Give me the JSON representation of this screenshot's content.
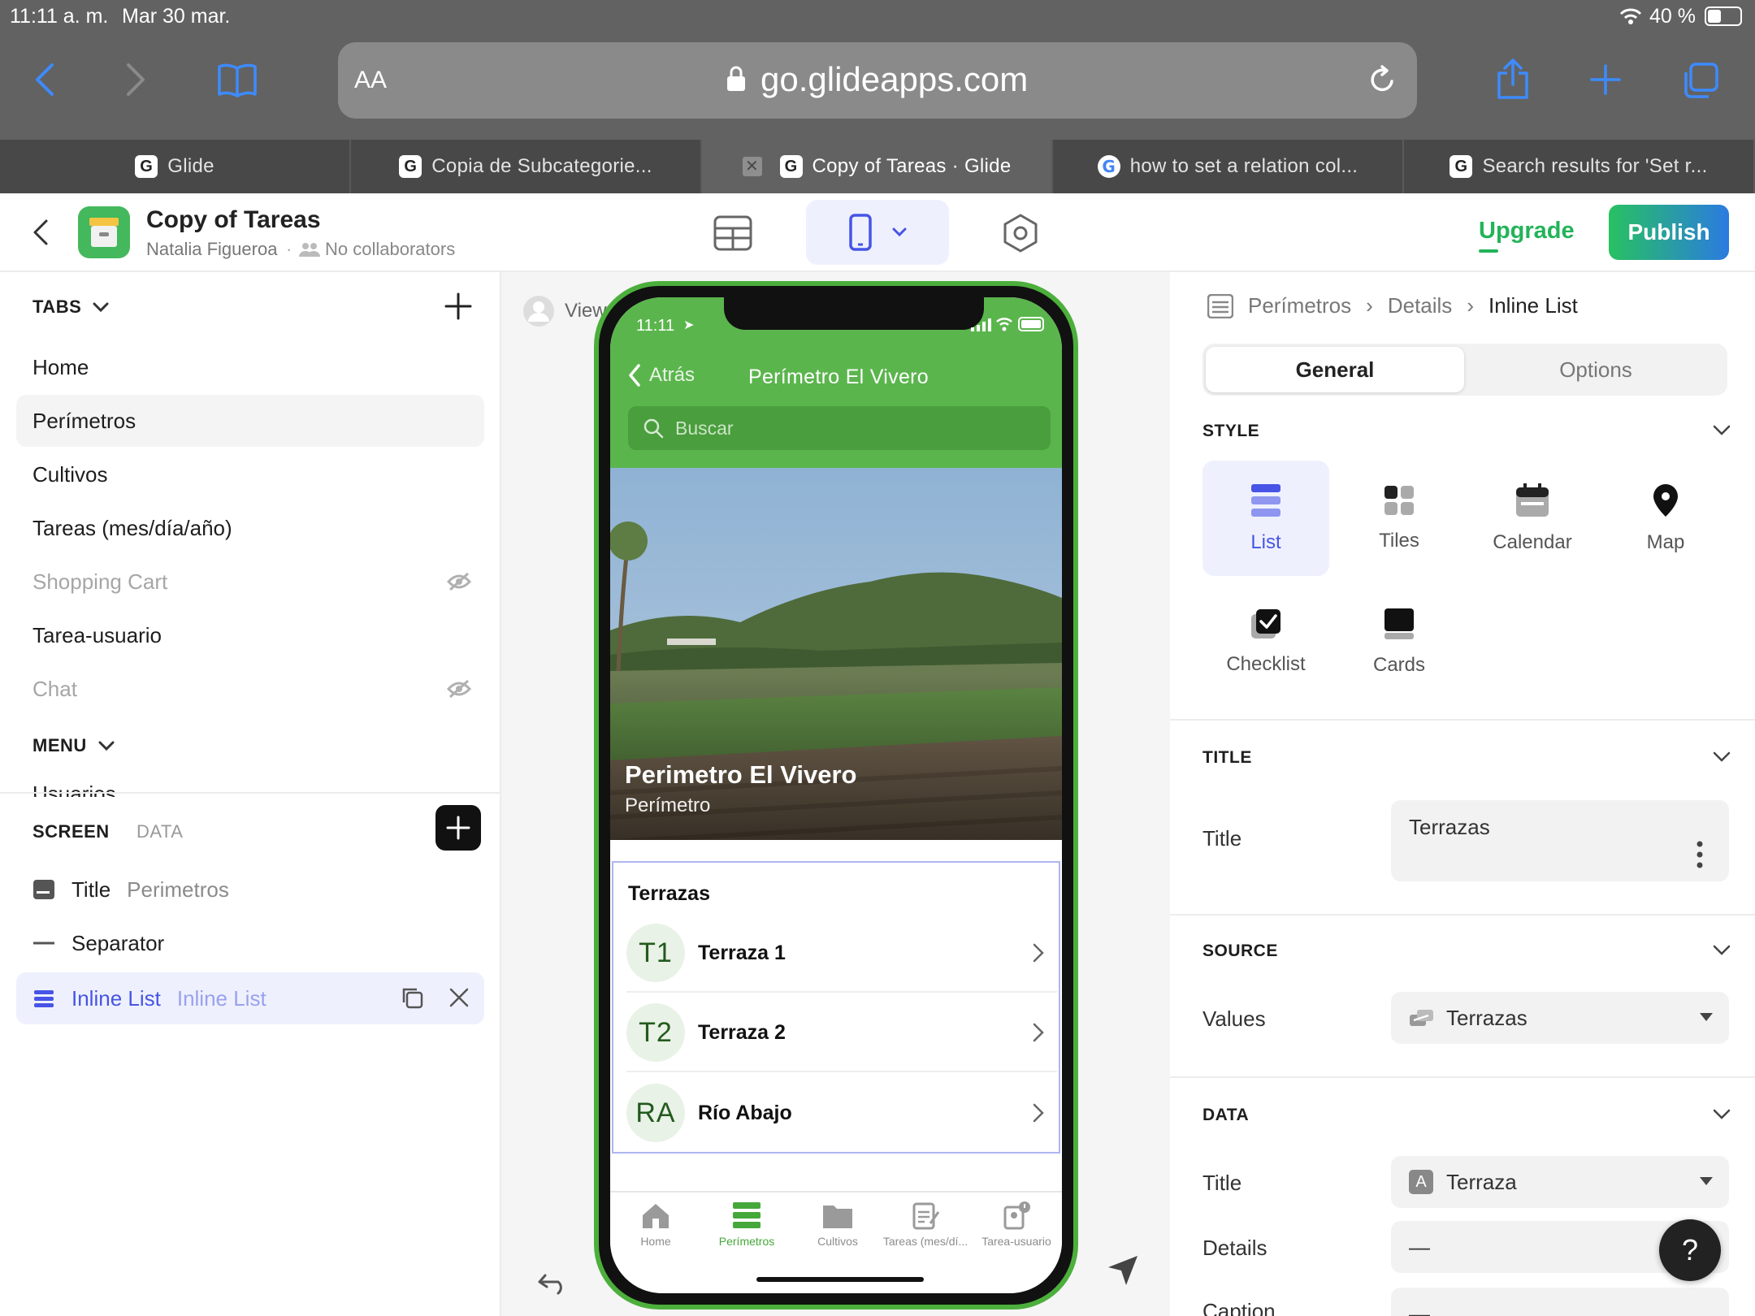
{
  "status_bar": {
    "time": "11:11 a. m.",
    "date": "Mar 30 mar.",
    "battery": "40 %"
  },
  "browser": {
    "text_size_label": "AA",
    "url": "go.glideapps.com",
    "tabs": [
      {
        "title": "Glide",
        "icon": "glide-icon"
      },
      {
        "title": "Copia de Subcategorie...",
        "icon": "glide-icon"
      },
      {
        "title": "Copy of Tareas · Glide",
        "icon": "glide-icon",
        "active": true
      },
      {
        "title": "how to set a relation col...",
        "icon": "google-icon"
      },
      {
        "title": "Search results for 'Set r...",
        "icon": "glide-icon"
      }
    ]
  },
  "app_header": {
    "app_name": "Copy of Tareas",
    "owner": "Natalia Figueroa",
    "collaborators": "No collaborators",
    "upgrade_label": "Upgrade",
    "publish_label": "Publish",
    "accent": "#4754e6",
    "green": "#2bbb62"
  },
  "left_panel": {
    "tabs_heading": "TABS",
    "tabs": [
      {
        "label": "Home",
        "hidden": false
      },
      {
        "label": "Perímetros",
        "hidden": false,
        "selected": true
      },
      {
        "label": "Cultivos",
        "hidden": false
      },
      {
        "label": "Tareas (mes/día/año)",
        "hidden": false
      },
      {
        "label": "Shopping Cart",
        "hidden": true
      },
      {
        "label": "Tarea-usuario",
        "hidden": false
      },
      {
        "label": "Chat",
        "hidden": true
      }
    ],
    "menu_heading": "MENU",
    "menu_partial": "Usuarios",
    "screen_tab": "SCREEN",
    "data_tab": "DATA",
    "components": [
      {
        "type": "Title",
        "name": "Perimetros"
      },
      {
        "type": "Separator",
        "name": ""
      },
      {
        "type": "Inline List",
        "name": "Inline List",
        "selected": true
      }
    ]
  },
  "canvas": {
    "viewing_as": "View",
    "phone": {
      "time": "11:11",
      "back_label": "Atrás",
      "title": "Perímetro El Vivero",
      "search_placeholder": "Buscar",
      "hero_title": "Perimetro El Vivero",
      "hero_subtitle": "Perímetro",
      "list_title": "Terrazas",
      "rows": [
        {
          "initials": "T1",
          "label": "Terraza 1"
        },
        {
          "initials": "T2",
          "label": "Terraza 2"
        },
        {
          "initials": "RA",
          "label": "Río Abajo"
        }
      ],
      "bottom_nav": [
        {
          "label": "Home",
          "icon": "home-icon"
        },
        {
          "label": "Perímetros",
          "icon": "list-icon",
          "active": true
        },
        {
          "label": "Cultivos",
          "icon": "folder-icon"
        },
        {
          "label": "Tareas (mes/dí...",
          "icon": "clipboard-icon"
        },
        {
          "label": "Tarea-usuario",
          "icon": "person-badge-icon"
        }
      ],
      "brand_green": "#5bb54d"
    }
  },
  "right_panel": {
    "breadcrumb": [
      "Perímetros",
      "Details",
      "Inline List"
    ],
    "seg_general": "General",
    "seg_options": "Options",
    "style_heading": "STYLE",
    "styles": [
      {
        "label": "List",
        "icon": "list-style-icon",
        "selected": true
      },
      {
        "label": "Tiles",
        "icon": "tiles-icon"
      },
      {
        "label": "Calendar",
        "icon": "calendar-icon"
      },
      {
        "label": "Map",
        "icon": "map-pin-icon"
      },
      {
        "label": "Checklist",
        "icon": "checkbox-icon"
      },
      {
        "label": "Cards",
        "icon": "cards-icon"
      }
    ],
    "title_heading": "TITLE",
    "title_label": "Title",
    "title_value": "Terrazas",
    "source_heading": "SOURCE",
    "values_label": "Values",
    "values_value": "Terrazas",
    "data_heading": "DATA",
    "data_title_label": "Title",
    "data_title_value": "Terraza",
    "details_label": "Details",
    "details_value": "—",
    "caption_label": "Caption",
    "caption_value": "—",
    "help_label": "?"
  }
}
